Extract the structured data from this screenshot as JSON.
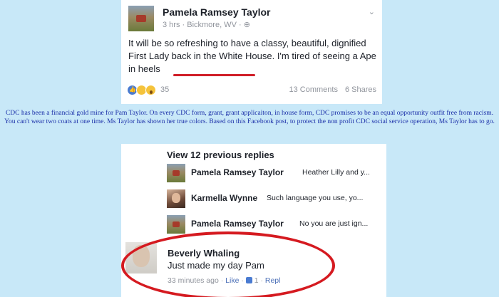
{
  "post": {
    "author": "Pamela Ramsey Taylor",
    "meta": "3 hrs · Bickmore, WV · ",
    "privacy_icon": "public-globe-icon",
    "body": "It will be so refreshing to have a classy, beautiful, dignified First Lady back in the White House. I'm tired of seeing a Ape in heels",
    "highlighted_phrase": "a Ape in heels",
    "highlight_color": "#d01e28",
    "reactions": [
      "like",
      "haha",
      "wow"
    ],
    "reaction_count": "35",
    "comments": "13 Comments",
    "shares": "6 Shares"
  },
  "caption": "CDC has been a financial gold mine for Pam Taylor. On every CDC form, grant, grant applicaiton, in house form, CDC promises to be an equal opportunity outfit free from racism. You can't wear two coats at one time. Ms Taylor has shown her true colors. Based on this Facebook post, to protect the non profit CDC social service operation, Ms Taylor has to go.",
  "caption_color": "#1a2ea8",
  "thread": {
    "view_previous": "View 12 previous replies",
    "replies": [
      {
        "name": "Pamela Ramsey Taylor",
        "text": "Heather Lilly  and y..."
      },
      {
        "name": "Karmella Wynne",
        "text": "Such language you use, yo..."
      },
      {
        "name": "Pamela Ramsey Taylor",
        "text": "No you are just ign..."
      }
    ],
    "highlighted_comment": {
      "name": "Beverly Whaling",
      "text": "Just made my day Pam",
      "time": "33 minutes ago",
      "sep": "·",
      "like": "Like",
      "likes_count": "1",
      "reply": "Repl"
    },
    "circle_color": "#d51a20"
  }
}
